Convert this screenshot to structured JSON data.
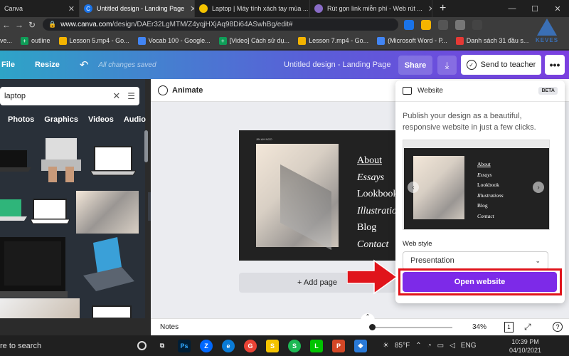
{
  "browser": {
    "tabs": [
      {
        "title": "Canva",
        "fav_color": "#00c4cc"
      },
      {
        "title": "Untitled design - Landing Page",
        "fav_color": "#1a73e8",
        "active": true
      },
      {
        "title": "Laptop | Máy tính xách tay mùa ...",
        "fav_color": "#f5c400"
      },
      {
        "title": "Rút gọn link miễn phí - Web rút ...",
        "fav_color": "#8a6cc7"
      }
    ],
    "new_tab": "+",
    "url_host": "www.canva.com",
    "url_path": "/design/DAEr32LgMTM/Z4yqjHXjAq98Di64ASwhBg/edit#",
    "bookmarks": [
      {
        "label": "ve...",
        "color": "#4285f4"
      },
      {
        "label": "outline",
        "color": "#0f9d58"
      },
      {
        "label": "Lesson 5.mp4 - Go...",
        "color": "#f4b400"
      },
      {
        "label": "Vocab 100 - Google...",
        "color": "#4285f4"
      },
      {
        "label": "[Video] Cách sử dụ...",
        "color": "#0f9d58"
      },
      {
        "label": "Lesson 7.mp4 - Go...",
        "color": "#f4b400"
      },
      {
        "label": "(Microsoft Word - P...",
        "color": "#4285f4"
      },
      {
        "label": "Danh sách 31 đầu s...",
        "color": "#e53935"
      }
    ],
    "brand_text": "KEVES"
  },
  "canva": {
    "file": "File",
    "resize": "Resize",
    "saved": "All changes saved",
    "title": "Untitled design - Landing Page",
    "share": "Share",
    "send": "Send to teacher",
    "search_value": "laptop",
    "categories": [
      "Photos",
      "Graphics",
      "Videos",
      "Audio"
    ],
    "animate": "Animate",
    "page_tiny": "JIN AH NOO",
    "menu": [
      "About",
      "Essays",
      "Lookbook",
      "Illustrations",
      "Blog",
      "Contact"
    ],
    "add_page": "+ Add page",
    "notes": "Notes",
    "zoom": "34%",
    "page_num": "1"
  },
  "popup": {
    "title": "Website",
    "badge": "BETA",
    "description": "Publish your design as a beautiful, responsive website in just a few clicks.",
    "preview_menu": [
      "About",
      "Essays",
      "Lookbook",
      "Illustrations",
      "Blog",
      "Contact"
    ],
    "web_style_label": "Web style",
    "web_style_value": "Presentation",
    "open_button": "Open website",
    "accent": "#7d2ae8",
    "highlight": "#e0141b"
  },
  "taskbar": {
    "search": "re to search",
    "apps": [
      {
        "label": "Ps",
        "color": "#001e36"
      },
      {
        "label": "Z",
        "color": "#0068ff"
      },
      {
        "label": "e",
        "color": "#0a7bd6"
      },
      {
        "label": "G",
        "color": "#ea4335"
      },
      {
        "label": "S",
        "color": "#f5c400"
      },
      {
        "label": "S",
        "color": "#1db954"
      },
      {
        "label": "L",
        "color": "#00c300"
      },
      {
        "label": "P",
        "color": "#d24726"
      },
      {
        "label": "◆",
        "color": "#2a7ad8"
      }
    ],
    "temperature": "85°F",
    "language": "ENG",
    "time": "10:39 PM",
    "date": "04/10/2021"
  }
}
